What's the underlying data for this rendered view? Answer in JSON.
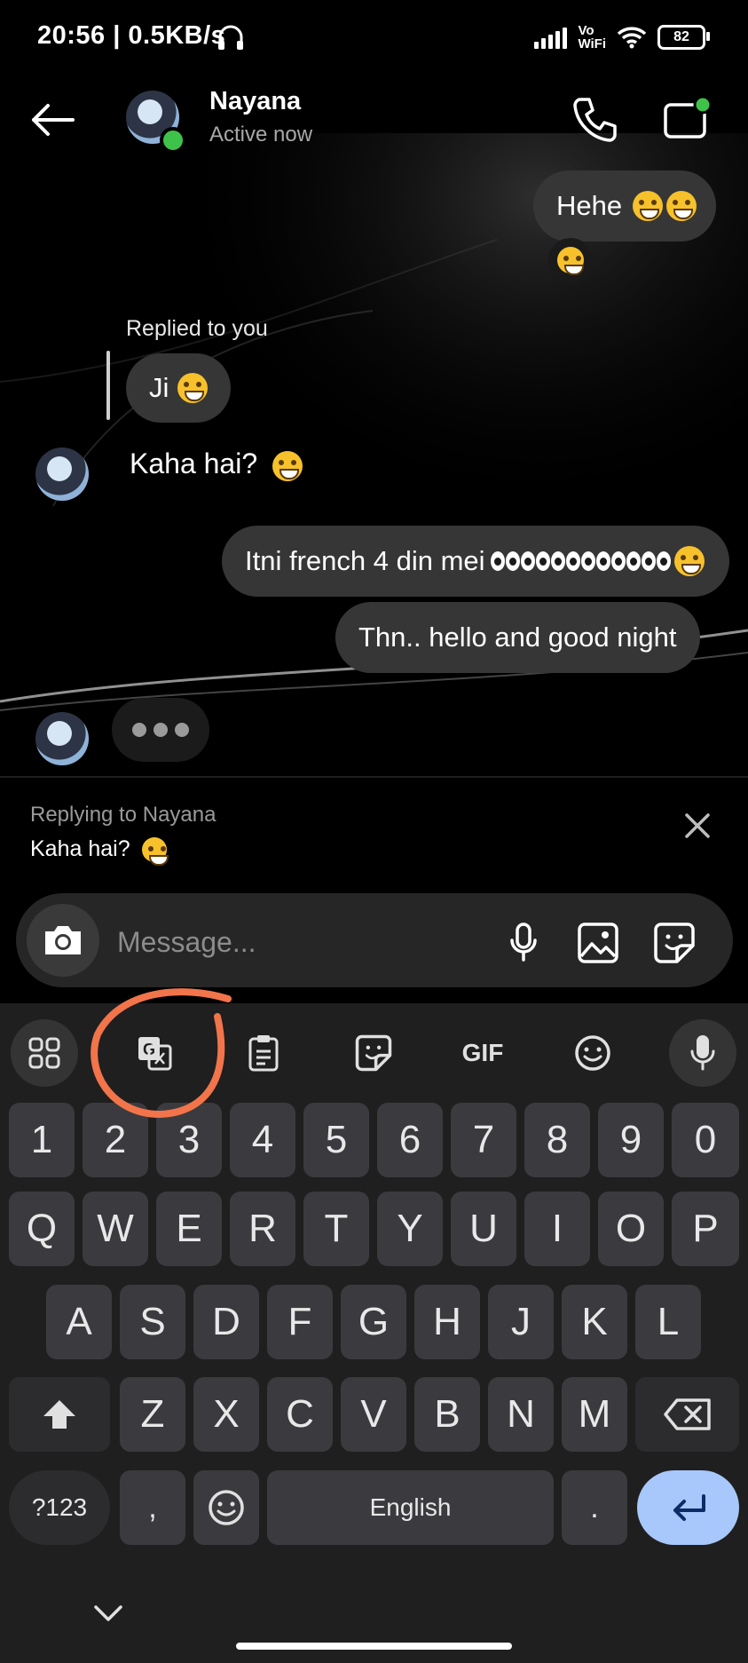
{
  "status_bar": {
    "time": "20:56 | 0.5KB/s",
    "network_label_top": "Vo",
    "network_label_bottom": "WiFi",
    "battery": "82"
  },
  "header": {
    "contact_name": "Nayana",
    "contact_status": "Active now",
    "icons": [
      "back-arrow-icon",
      "phone-icon",
      "video-call-icon"
    ]
  },
  "messages": [
    {
      "side": "sent",
      "text": "Hehe",
      "emoji": "grinning-face x2",
      "reaction": "tears-of-joy"
    },
    {
      "side": "received",
      "reply_label": "Replied to you",
      "text": "Ji",
      "emoji": "rolling-on-floor-laughing"
    },
    {
      "side": "received",
      "text": "Kaha hai?",
      "emoji": "grinning-sweat"
    },
    {
      "side": "sent",
      "text": "Itni french 4 din mei",
      "emoji": "eyes x6, grinning-sweat"
    },
    {
      "side": "sent",
      "text": "Thn.. hello and good night"
    }
  ],
  "typing_indicator": true,
  "reply_bar": {
    "title": "Replying to Nayana",
    "text": "Kaha hai?"
  },
  "composer": {
    "placeholder": "Message..."
  },
  "keyboard": {
    "toolbar": [
      "apps-grid-icon",
      "translate-icon",
      "clipboard-icon",
      "sticker-icon",
      "gif-icon",
      "emoji-icon",
      "voice-mic-icon"
    ],
    "gif_label": "GIF",
    "rows": [
      [
        "1",
        "2",
        "3",
        "4",
        "5",
        "6",
        "7",
        "8",
        "9",
        "0"
      ],
      [
        "Q",
        "W",
        "E",
        "R",
        "T",
        "Y",
        "U",
        "I",
        "O",
        "P"
      ],
      [
        "A",
        "S",
        "D",
        "F",
        "G",
        "H",
        "J",
        "K",
        "L"
      ],
      [
        "Z",
        "X",
        "C",
        "V",
        "B",
        "N",
        "M"
      ]
    ],
    "symbols_key": "?123",
    "comma_key": ",",
    "space_label": "English",
    "period_key": ".",
    "enter_color": "#a8c7fa"
  },
  "annotation_color": "#f2744a"
}
